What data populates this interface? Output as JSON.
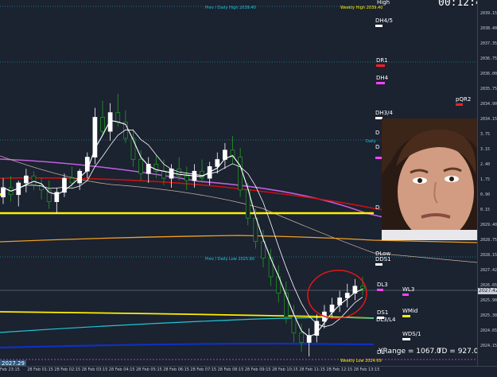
{
  "clock": "00:12:45",
  "header": {
    "prev_daily_high": "Prev / Daily High 2039.40",
    "weekly_high": "Weekly High 2039.40",
    "high": "High"
  },
  "levels": {
    "dh45": "DH4/5",
    "dr1": "DR1",
    "dh4": "DH4",
    "pqr2": "pQR2",
    "dh34": "DH3/4",
    "d1": "D",
    "d2": "D",
    "daily": "Daily",
    "d3": "D",
    "dlow": "DLow",
    "dds1": "DDS1",
    "dl3": "DL3",
    "wl3": "WL3",
    "ds1": "DS1",
    "wmid": "WMid",
    "dl34": "DL3/L4",
    "wdsi": "WDS/1",
    "dl": "DL",
    "prev_daily_low": "Prev / Daily Low 2025.80",
    "weekly_low": "Weekly Low 2024.69",
    "current_price": "2027.29",
    "price_box": "2027.42"
  },
  "stats": {
    "yrange": "YRange = 1067.0",
    "td": "TD = 927.0"
  },
  "price_axis": [
    "2039.15",
    "2038.40",
    "2037.35",
    "2036.75",
    "2036.00",
    "2035.75",
    "2034.90",
    "2034.15",
    "3.75",
    "3.15",
    "2.40",
    "1.75",
    "0.90",
    "0.15",
    "2029.40",
    "2028.75",
    "2028.15",
    "2027.42",
    "2026.65",
    "2025.90",
    "2025.30",
    "2024.65",
    "2024.15"
  ],
  "time_axis": [
    "Feb 23:15",
    "28 Feb 01:15",
    "28 Feb 02:15",
    "28 Feb 03:15",
    "28 Feb 04:15",
    "28 Feb 05:15",
    "28 Feb 06:15",
    "28 Feb 07:15",
    "28 Feb 08:15",
    "28 Feb 09:15",
    "28 Feb 10:15",
    "28 Feb 11:15",
    "28 Feb 12:15",
    "28 Feb 13:15"
  ],
  "colors": {
    "background": "#1b2230",
    "yellow": "#ffef00",
    "red": "#cc1010",
    "purple": "#c060e0",
    "orange": "#f0a020",
    "cyan": "#20c8d8",
    "blue": "#1030c0",
    "candle_up": "#ffffff",
    "candle_down": "#20a020",
    "circle": "#e01818"
  },
  "chart_data": {
    "type": "candlestick",
    "candles": [
      [
        2031.2,
        2032.0,
        2030.9,
        2031.6
      ],
      [
        2031.6,
        2032.1,
        2031.0,
        2031.3
      ],
      [
        2031.3,
        2031.9,
        2030.8,
        2031.8
      ],
      [
        2031.8,
        2032.4,
        2031.4,
        2032.1
      ],
      [
        2032.1,
        2032.3,
        2031.5,
        2031.7
      ],
      [
        2031.7,
        2032.0,
        2031.1,
        2031.5
      ],
      [
        2031.5,
        2031.9,
        2030.7,
        2031.0
      ],
      [
        2031.0,
        2031.6,
        2030.5,
        2031.4
      ],
      [
        2031.4,
        2032.2,
        2031.2,
        2032.0
      ],
      [
        2032.0,
        2032.5,
        2031.6,
        2031.8
      ],
      [
        2031.8,
        2032.4,
        2031.5,
        2032.3
      ],
      [
        2032.3,
        2033.1,
        2032.0,
        2032.9
      ],
      [
        2032.9,
        2035.0,
        2032.6,
        2034.6
      ],
      [
        2034.6,
        2035.3,
        2033.8,
        2034.0
      ],
      [
        2034.0,
        2035.2,
        2033.6,
        2034.8
      ],
      [
        2034.8,
        2035.6,
        2034.2,
        2034.4
      ],
      [
        2034.4,
        2034.9,
        2033.5,
        2033.7
      ],
      [
        2033.7,
        2034.1,
        2032.5,
        2032.8
      ],
      [
        2032.8,
        2033.2,
        2031.9,
        2032.2
      ],
      [
        2032.2,
        2032.9,
        2031.8,
        2032.6
      ],
      [
        2032.6,
        2033.0,
        2032.0,
        2032.3
      ],
      [
        2032.3,
        2032.8,
        2031.7,
        2032.0
      ],
      [
        2032.0,
        2032.6,
        2031.6,
        2032.4
      ],
      [
        2032.4,
        2032.9,
        2031.9,
        2032.1
      ],
      [
        2032.1,
        2032.5,
        2031.5,
        2031.9
      ],
      [
        2031.9,
        2032.6,
        2031.6,
        2032.3
      ],
      [
        2032.3,
        2032.8,
        2031.8,
        2032.0
      ],
      [
        2032.0,
        2032.7,
        2031.7,
        2032.5
      ],
      [
        2032.5,
        2033.1,
        2032.2,
        2032.8
      ],
      [
        2032.8,
        2033.5,
        2032.4,
        2033.2
      ],
      [
        2033.2,
        2033.8,
        2032.6,
        2032.9
      ],
      [
        2032.9,
        2033.3,
        2031.2,
        2031.5
      ],
      [
        2031.5,
        2031.8,
        2030.0,
        2030.3
      ],
      [
        2030.3,
        2030.7,
        2029.0,
        2029.3
      ],
      [
        2029.3,
        2029.8,
        2028.2,
        2028.6
      ],
      [
        2028.6,
        2029.0,
        2027.4,
        2027.8
      ],
      [
        2027.8,
        2028.3,
        2026.7,
        2027.1
      ],
      [
        2027.1,
        2027.6,
        2025.8,
        2026.1
      ],
      [
        2026.1,
        2026.6,
        2025.0,
        2025.4
      ],
      [
        2025.4,
        2025.8,
        2024.6,
        2025.0
      ],
      [
        2025.0,
        2025.6,
        2024.4,
        2025.3
      ],
      [
        2025.3,
        2026.2,
        2025.0,
        2025.9
      ],
      [
        2025.9,
        2026.6,
        2025.6,
        2026.3
      ],
      [
        2026.3,
        2026.9,
        2026.0,
        2026.6
      ],
      [
        2026.6,
        2027.2,
        2026.3,
        2026.9
      ],
      [
        2026.9,
        2027.5,
        2026.5,
        2027.1
      ],
      [
        2027.1,
        2027.7,
        2026.8,
        2027.4
      ],
      [
        2027.4,
        2027.8,
        2027.0,
        2027.3
      ]
    ],
    "ylim": [
      2024.0,
      2039.6
    ]
  }
}
